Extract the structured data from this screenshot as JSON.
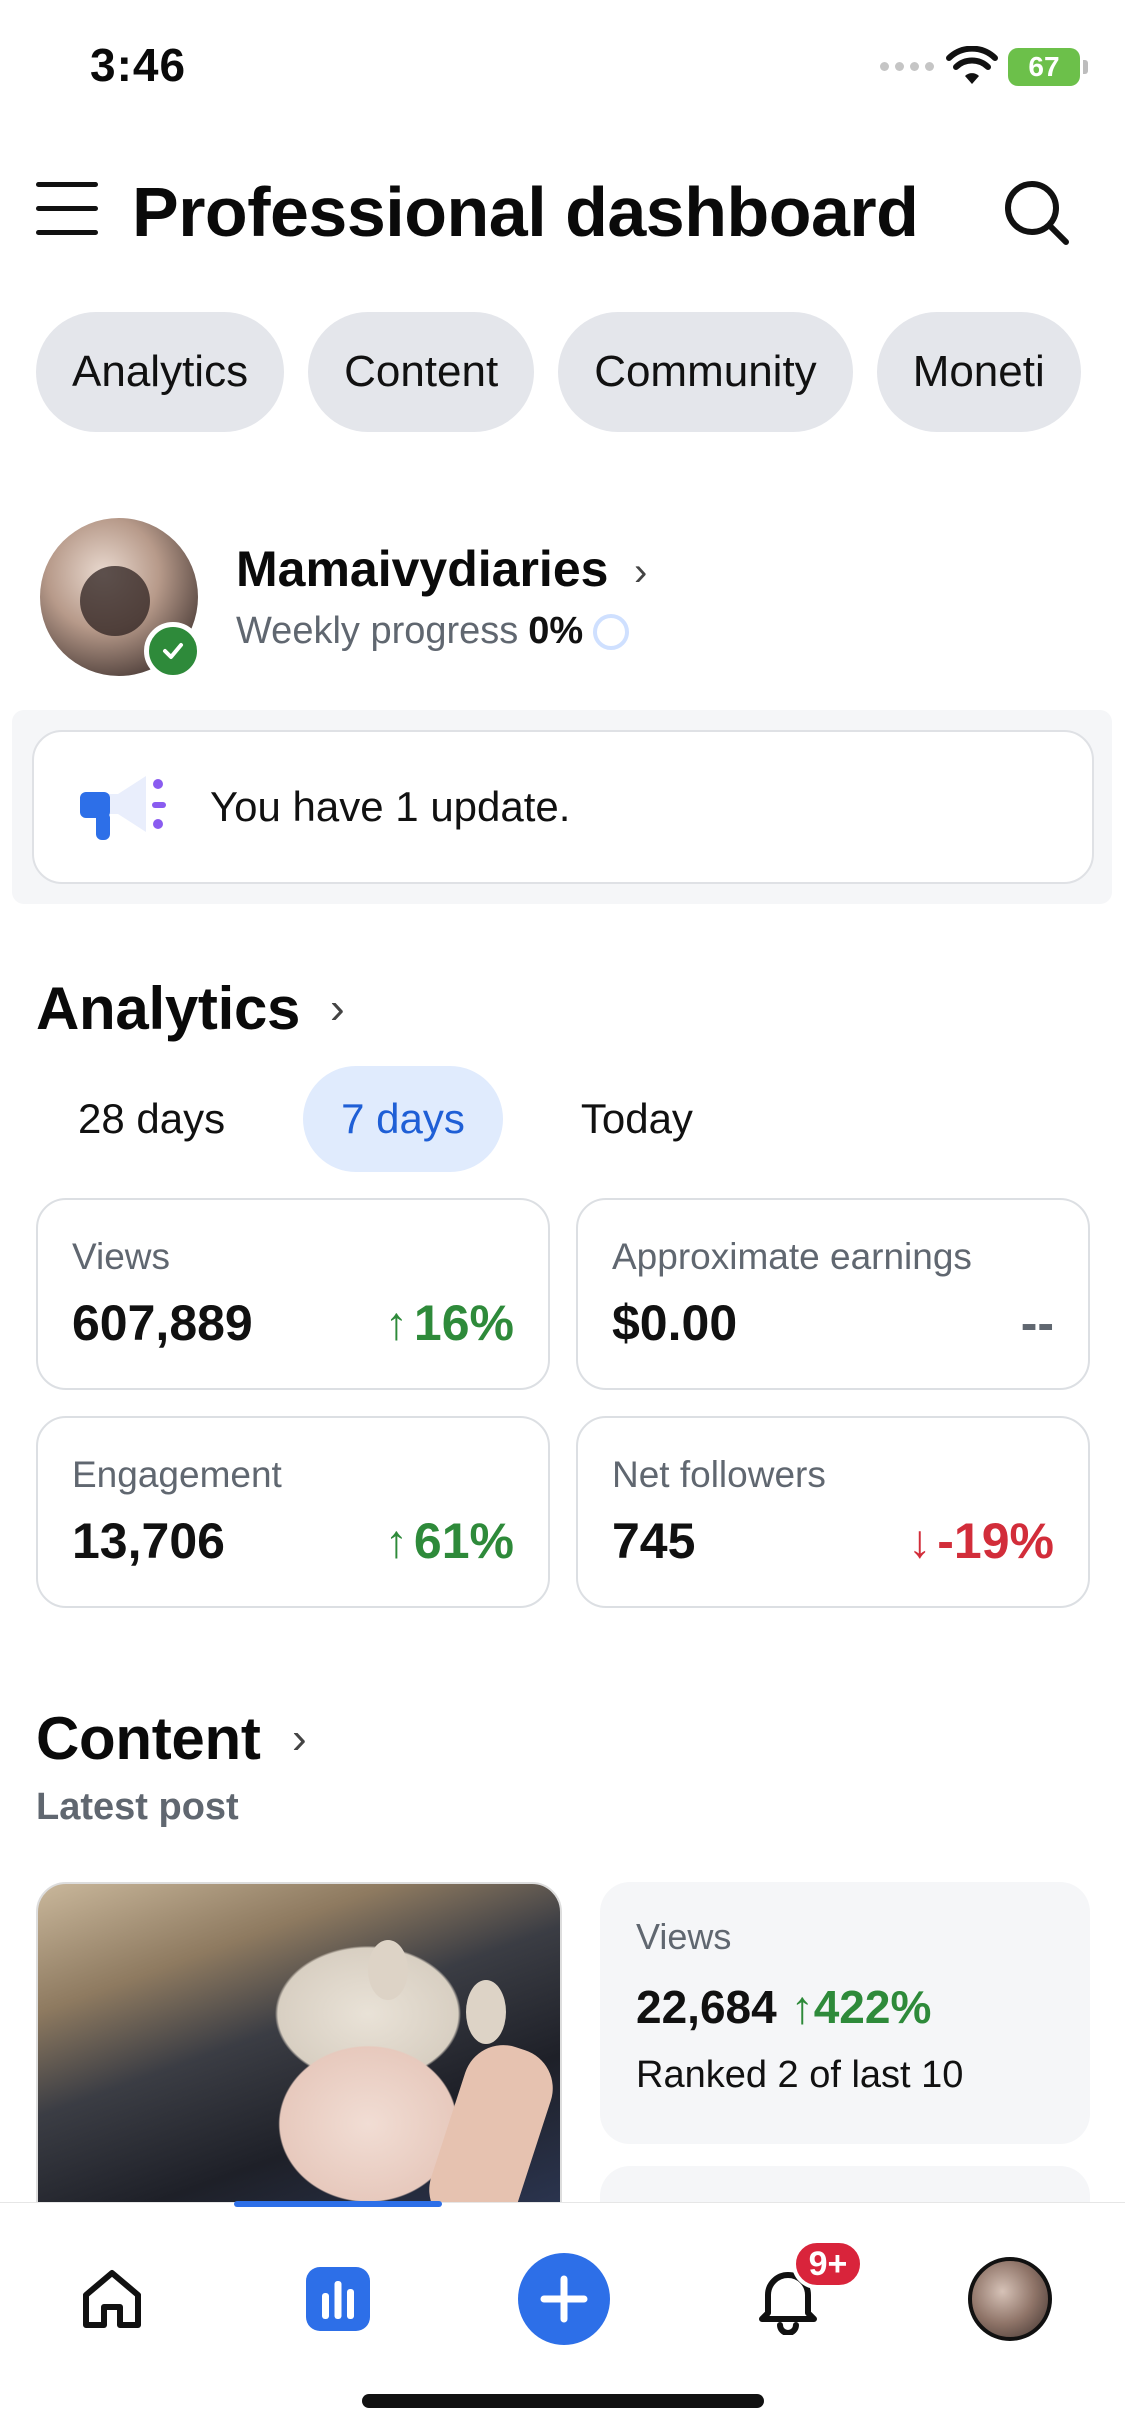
{
  "status_bar": {
    "time": "3:46",
    "battery": "67"
  },
  "header": {
    "title": "Professional dashboard"
  },
  "tabs": [
    {
      "label": "Analytics"
    },
    {
      "label": "Content"
    },
    {
      "label": "Community"
    },
    {
      "label": "Moneti"
    }
  ],
  "profile": {
    "name": "Mamaivydiaries",
    "progress_label": "Weekly progress",
    "progress_value": "0%"
  },
  "update": {
    "text": "You have 1 update."
  },
  "analytics": {
    "title": "Analytics",
    "ranges": [
      {
        "label": "28 days",
        "active": false
      },
      {
        "label": "7 days",
        "active": true
      },
      {
        "label": "Today",
        "active": false
      }
    ],
    "stats": [
      {
        "label": "Views",
        "value": "607,889",
        "delta": "16%",
        "trend": "up"
      },
      {
        "label": "Approximate earnings",
        "value": "$0.00",
        "delta": "--",
        "trend": "none"
      },
      {
        "label": "Engagement",
        "value": "13,706",
        "delta": "61%",
        "trend": "up"
      },
      {
        "label": "Net followers",
        "value": "745",
        "delta": "-19%",
        "trend": "down"
      }
    ]
  },
  "content": {
    "title": "Content",
    "subtitle": "Latest post",
    "post": {
      "views_label": "Views",
      "views": "22,684",
      "views_delta": "422%",
      "rank": "Ranked 2 of last 10"
    }
  },
  "bottom_nav": {
    "items": [
      "home-icon",
      "analytics-icon",
      "create-icon",
      "notifications-icon",
      "profile-avatar"
    ],
    "notification_badge": "9+",
    "active": "analytics"
  },
  "colors": {
    "accent": "#2d6fe8",
    "positive": "#2e8a3a",
    "negative": "#d22d3a",
    "chip_bg": "#e4e6eb"
  }
}
